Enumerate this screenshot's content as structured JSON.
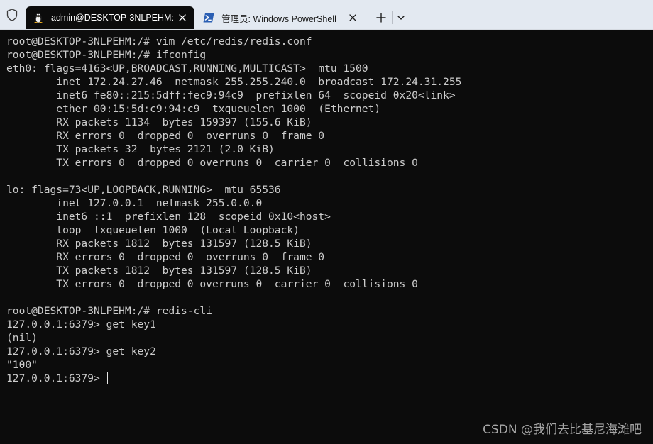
{
  "tabs": [
    {
      "title": "admin@DESKTOP-3NLPEHM: ,",
      "icon": "linux-tux-icon",
      "active": true
    },
    {
      "title": "管理员: Windows PowerShell",
      "icon": "powershell-icon",
      "active": false
    }
  ],
  "new_tab_glyph": "+",
  "terminal_lines": [
    "root@DESKTOP-3NLPEHM:/# vim /etc/redis/redis.conf",
    "root@DESKTOP-3NLPEHM:/# ifconfig",
    "eth0: flags=4163<UP,BROADCAST,RUNNING,MULTICAST>  mtu 1500",
    "        inet 172.24.27.46  netmask 255.255.240.0  broadcast 172.24.31.255",
    "        inet6 fe80::215:5dff:fec9:94c9  prefixlen 64  scopeid 0x20<link>",
    "        ether 00:15:5d:c9:94:c9  txqueuelen 1000  (Ethernet)",
    "        RX packets 1134  bytes 159397 (155.6 KiB)",
    "        RX errors 0  dropped 0  overruns 0  frame 0",
    "        TX packets 32  bytes 2121 (2.0 KiB)",
    "        TX errors 0  dropped 0 overruns 0  carrier 0  collisions 0",
    "",
    "lo: flags=73<UP,LOOPBACK,RUNNING>  mtu 65536",
    "        inet 127.0.0.1  netmask 255.0.0.0",
    "        inet6 ::1  prefixlen 128  scopeid 0x10<host>",
    "        loop  txqueuelen 1000  (Local Loopback)",
    "        RX packets 1812  bytes 131597 (128.5 KiB)",
    "        RX errors 0  dropped 0  overruns 0  frame 0",
    "        TX packets 1812  bytes 131597 (128.5 KiB)",
    "        TX errors 0  dropped 0 overruns 0  carrier 0  collisions 0",
    "",
    "root@DESKTOP-3NLPEHM:/# redis-cli",
    "127.0.0.1:6379> get key1",
    "(nil)",
    "127.0.0.1:6379> get key2",
    "\"100\"",
    "127.0.0.1:6379> "
  ],
  "watermark": "CSDN @我们去比基尼海滩吧",
  "colors": {
    "tabbar_bg": "#e3e9f1",
    "terminal_bg": "#0c0c0c",
    "terminal_fg": "#cccccc",
    "powershell_icon_bg": "#2b5fb3"
  }
}
